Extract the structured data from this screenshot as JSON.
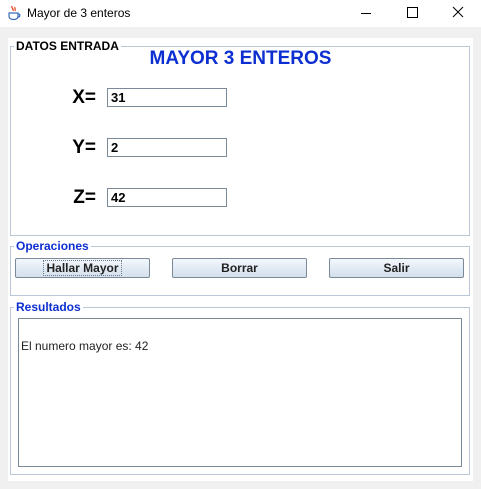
{
  "window": {
    "title": "Mayor de 3 enteros",
    "icon": "java-cup-icon",
    "controls": [
      "minimize",
      "maximize",
      "close"
    ]
  },
  "datos_entrada": {
    "legend": "DATOS ENTRADA",
    "heading": "MAYOR 3 ENTEROS",
    "fields": [
      {
        "label": "X=",
        "value": "31"
      },
      {
        "label": "Y=",
        "value": "2"
      },
      {
        "label": "Z=",
        "value": "42"
      }
    ]
  },
  "operaciones": {
    "legend": "Operaciones",
    "buttons": {
      "hallar": "Hallar Mayor",
      "borrar": "Borrar",
      "salir": "Salir"
    }
  },
  "resultados": {
    "legend": "Resultados",
    "text": "El numero mayor es: 42"
  },
  "colors": {
    "accent": "#0d2fd1",
    "border": "#b9c7d6"
  }
}
